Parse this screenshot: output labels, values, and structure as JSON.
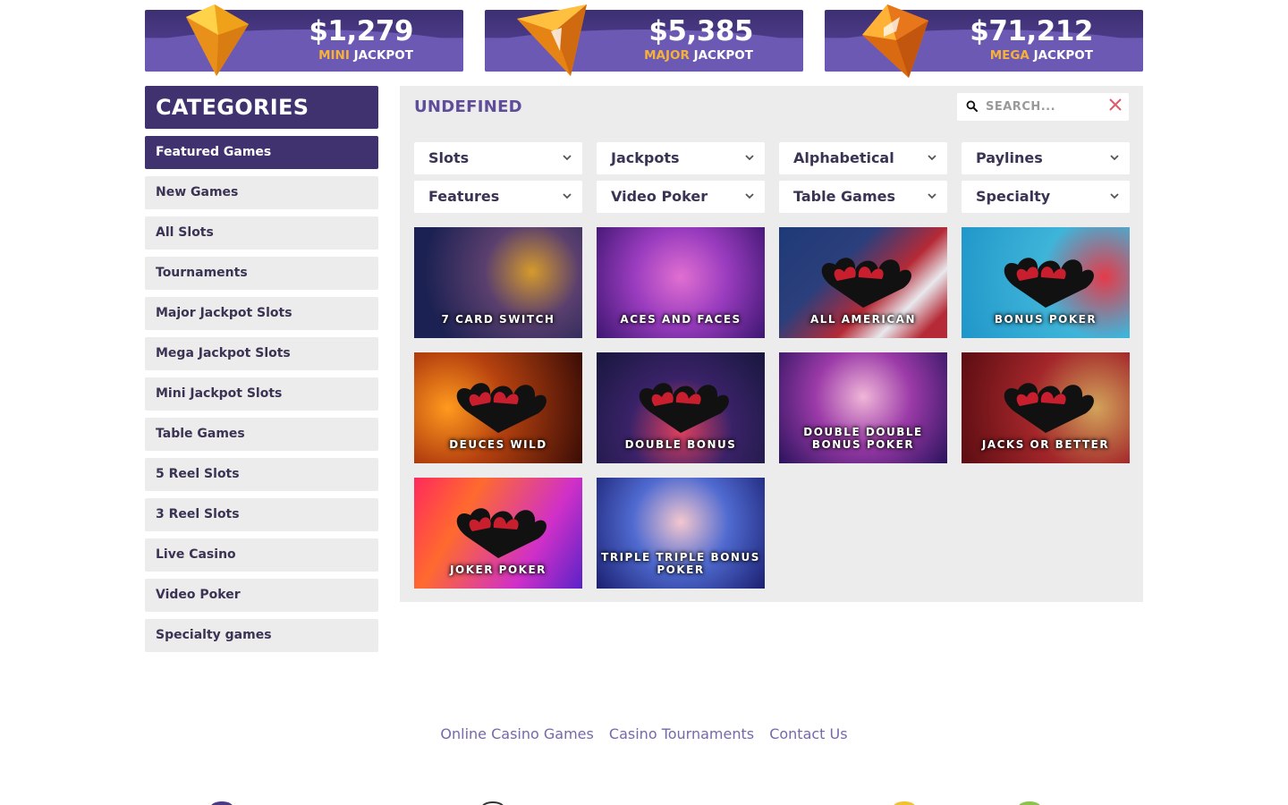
{
  "jackpots": [
    {
      "amount": "$1,279",
      "tier": "MINI",
      "suffix": "JACKPOT"
    },
    {
      "amount": "$5,385",
      "tier": "MAJOR",
      "suffix": "JACKPOT"
    },
    {
      "amount": "$71,212",
      "tier": "MEGA",
      "suffix": "JACKPOT"
    }
  ],
  "sidebar": {
    "heading": "CATEGORIES",
    "items": [
      {
        "label": "Featured Games"
      },
      {
        "label": "New Games"
      },
      {
        "label": "All Slots"
      },
      {
        "label": "Tournaments"
      },
      {
        "label": "Major Jackpot Slots"
      },
      {
        "label": "Mega Jackpot Slots"
      },
      {
        "label": "Mini Jackpot Slots"
      },
      {
        "label": "Table Games"
      },
      {
        "label": "5 Reel Slots"
      },
      {
        "label": "3 Reel Slots"
      },
      {
        "label": "Live Casino"
      },
      {
        "label": "Video Poker"
      },
      {
        "label": "Specialty games"
      }
    ]
  },
  "main": {
    "title": "UNDEFINED",
    "search": {
      "placeholder": "SEARCH..."
    },
    "filters": [
      {
        "label": "Slots"
      },
      {
        "label": "Jackpots"
      },
      {
        "label": "Alphabetical"
      },
      {
        "label": "Paylines"
      },
      {
        "label": "Features"
      },
      {
        "label": "Video Poker"
      },
      {
        "label": "Table Games"
      },
      {
        "label": "Specialty"
      }
    ],
    "games": [
      {
        "title": "7 CARD SWITCH"
      },
      {
        "title": "ACES AND FACES"
      },
      {
        "title": "ALL AMERICAN"
      },
      {
        "title": "BONUS POKER"
      },
      {
        "title": "DEUCES WILD"
      },
      {
        "title": "DOUBLE BONUS"
      },
      {
        "title": "DOUBLE DOUBLE BONUS POKER"
      },
      {
        "title": "JACKS OR BETTER"
      },
      {
        "title": "JOKER POKER"
      },
      {
        "title": "TRIPLE TRIPLE BONUS POKER"
      }
    ]
  },
  "footer": {
    "links": [
      {
        "label": "Online Casino Games"
      },
      {
        "label": "Casino Tournaments"
      },
      {
        "label": "Contact Us"
      }
    ]
  },
  "colors": {
    "brand_purple": "#40326f",
    "accent_gold": "#f6b13c",
    "panel_bg": "#ececec",
    "title_purple": "#5f4d99",
    "close_red": "#e05a6a"
  },
  "icons": {
    "search": "search-icon",
    "close": "close-icon",
    "chevron": "chevron-down-icon",
    "gem": "gem-icon"
  }
}
